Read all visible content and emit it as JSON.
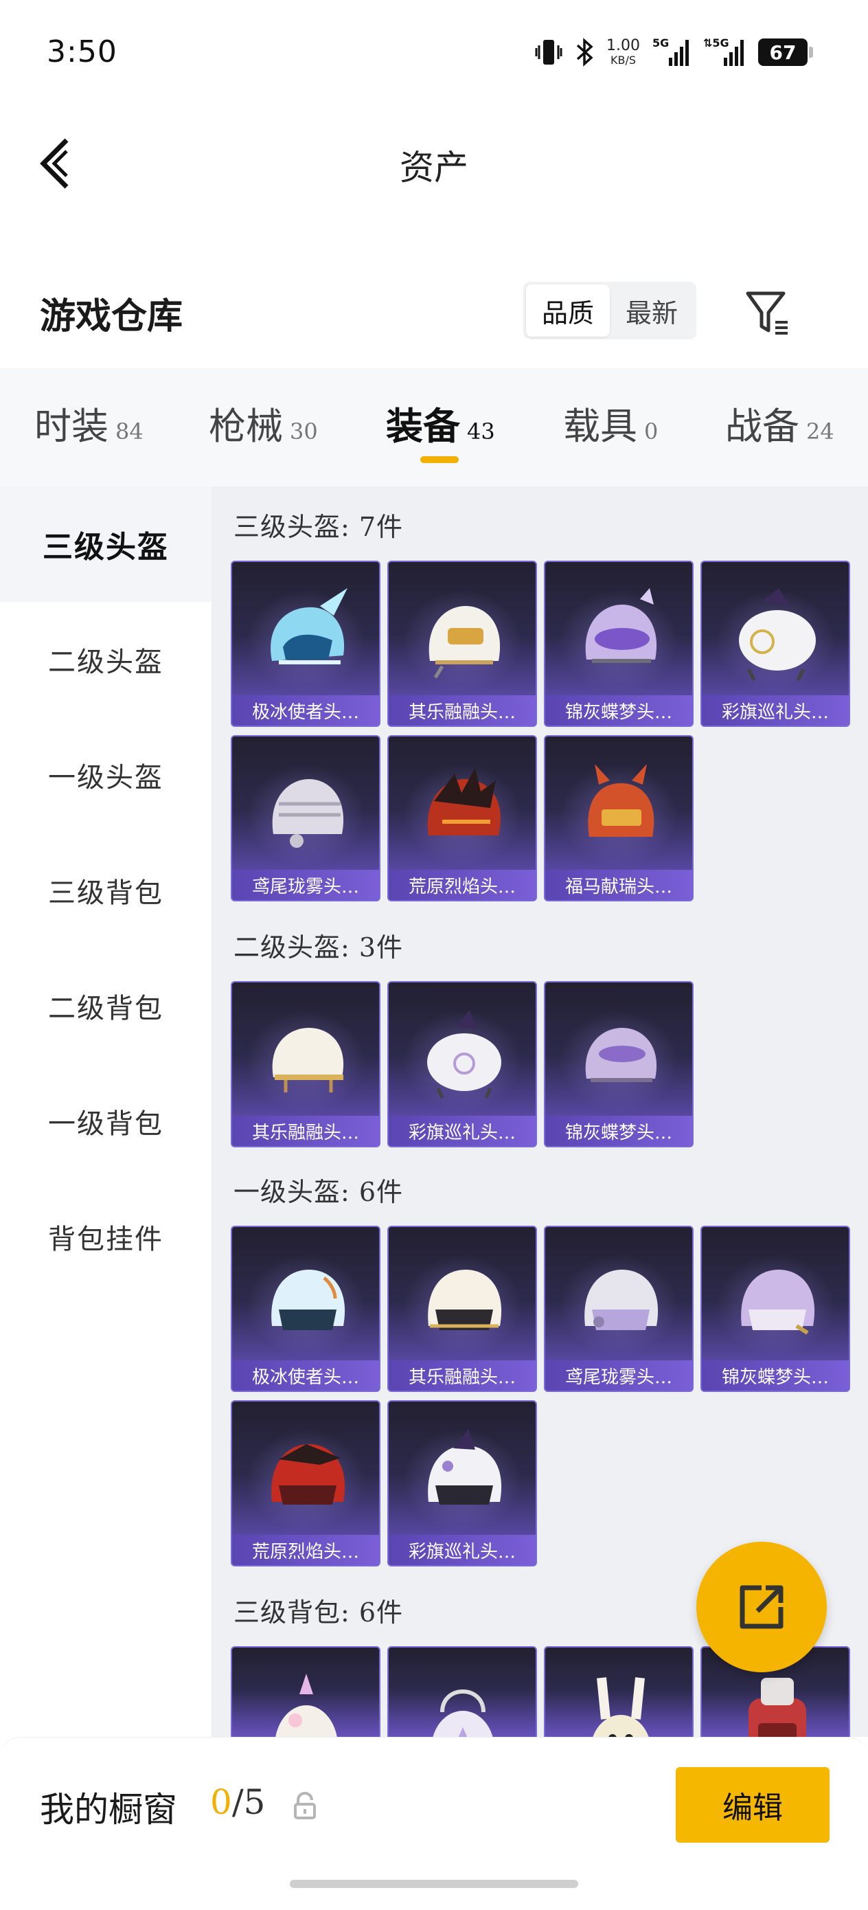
{
  "status_bar": {
    "time": "3:50",
    "net_speed_value": "1.00",
    "net_speed_unit": "KB/S",
    "sim1": "5G",
    "sim2": "5G",
    "battery": "67"
  },
  "header": {
    "title": "资产"
  },
  "section": {
    "title": "游戏仓库",
    "sort_options": [
      "品质",
      "最新"
    ],
    "sort_active": "品质"
  },
  "tabs": [
    {
      "label": "时装",
      "count": "84"
    },
    {
      "label": "枪械",
      "count": "30"
    },
    {
      "label": "装备",
      "count": "43"
    },
    {
      "label": "载具",
      "count": "0"
    },
    {
      "label": "战备",
      "count": "24"
    }
  ],
  "side_nav": [
    {
      "label": "三级头盔"
    },
    {
      "label": "二级头盔"
    },
    {
      "label": "一级头盔"
    },
    {
      "label": "三级背包"
    },
    {
      "label": "二级背包"
    },
    {
      "label": "一级背包"
    },
    {
      "label": "背包挂件"
    }
  ],
  "groups": [
    {
      "label": "三级头盔: 7件",
      "items": [
        "极冰使者头…",
        "其乐融融头…",
        "锦灰蝶梦头…",
        "彩旗巡礼头…",
        "鸢尾珑雾头…",
        "荒原烈焰头…",
        "福马献瑞头…"
      ]
    },
    {
      "label": "二级头盔: 3件",
      "items": [
        "其乐融融头…",
        "彩旗巡礼头…",
        "锦灰蝶梦头…"
      ]
    },
    {
      "label": "一级头盔: 6件",
      "items": [
        "极冰使者头…",
        "其乐融融头…",
        "鸢尾珑雾头…",
        "锦灰蝶梦头…",
        "荒原烈焰头…",
        "彩旗巡礼头…"
      ]
    },
    {
      "label": "三级背包: 6件",
      "items": []
    }
  ],
  "colors": {
    "accent": "#f6b700",
    "card_bg": "#2c2a4c",
    "card_caption": "#6a52c8"
  },
  "bottom_bar": {
    "title": "我的橱窗",
    "count_current": "0",
    "count_sep_total": "/5",
    "edit_label": "编辑"
  }
}
